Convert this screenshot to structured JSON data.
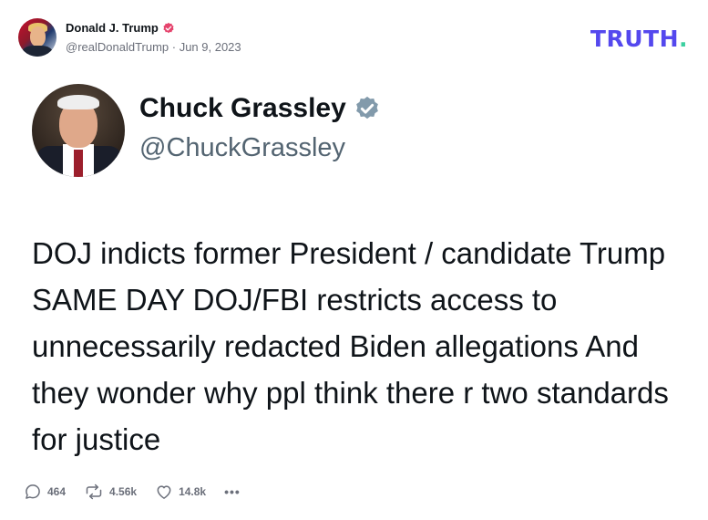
{
  "author": {
    "display_name": "Donald J. Trump",
    "handle_and_date": "@realDonaldTrump · Jun 9, 2023",
    "verified_icon": "verified-badge-icon"
  },
  "brand": {
    "logo_text": "TRUTH",
    "logo_dot": ".",
    "logo_color": "#5448ee",
    "dot_color": "#3cd0a0"
  },
  "quoted_post": {
    "name": "Chuck Grassley",
    "handle": "@ChuckGrassley",
    "text": "DOJ indicts former President / candidate Trump SAME DAY DOJ/FBI restricts access to unnecessarily redacted Biden allegations And they wonder why ppl think there r two standards for justice"
  },
  "actions": {
    "replies": "464",
    "retruths": "4.56k",
    "likes": "14.8k",
    "more": "•••"
  }
}
